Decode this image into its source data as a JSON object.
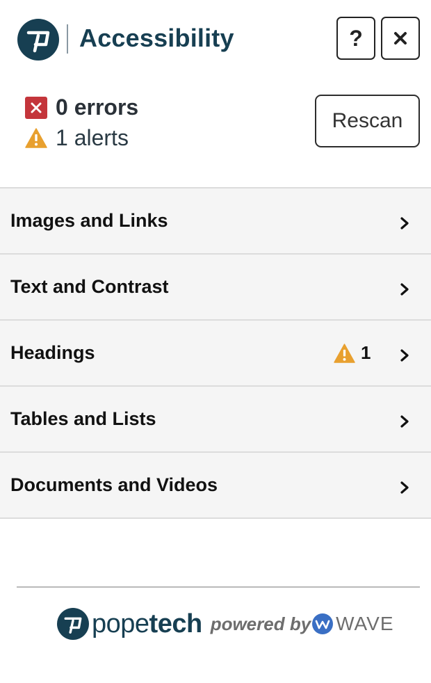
{
  "header": {
    "title": "Accessibility",
    "help_label": "?",
    "logo_icon": "popetech-logo-icon",
    "close_icon": "close-icon"
  },
  "summary": {
    "errors_text": "0 errors",
    "alerts_text": "1 alerts",
    "rescan_label": "Rescan"
  },
  "categories": [
    {
      "label": "Images and Links",
      "alerts": null
    },
    {
      "label": "Text and Contrast",
      "alerts": null
    },
    {
      "label": "Headings",
      "alerts": "1"
    },
    {
      "label": "Tables and Lists",
      "alerts": null
    },
    {
      "label": "Documents and Videos",
      "alerts": null
    }
  ],
  "footer": {
    "brand_light": "pope",
    "brand_bold": "tech",
    "powered_by": "powered by",
    "wave": "WAVE"
  },
  "colors": {
    "brand": "#173f52",
    "error": "#c4353b",
    "alert": "#e8a02f",
    "wave_blue": "#3a6fc4"
  }
}
